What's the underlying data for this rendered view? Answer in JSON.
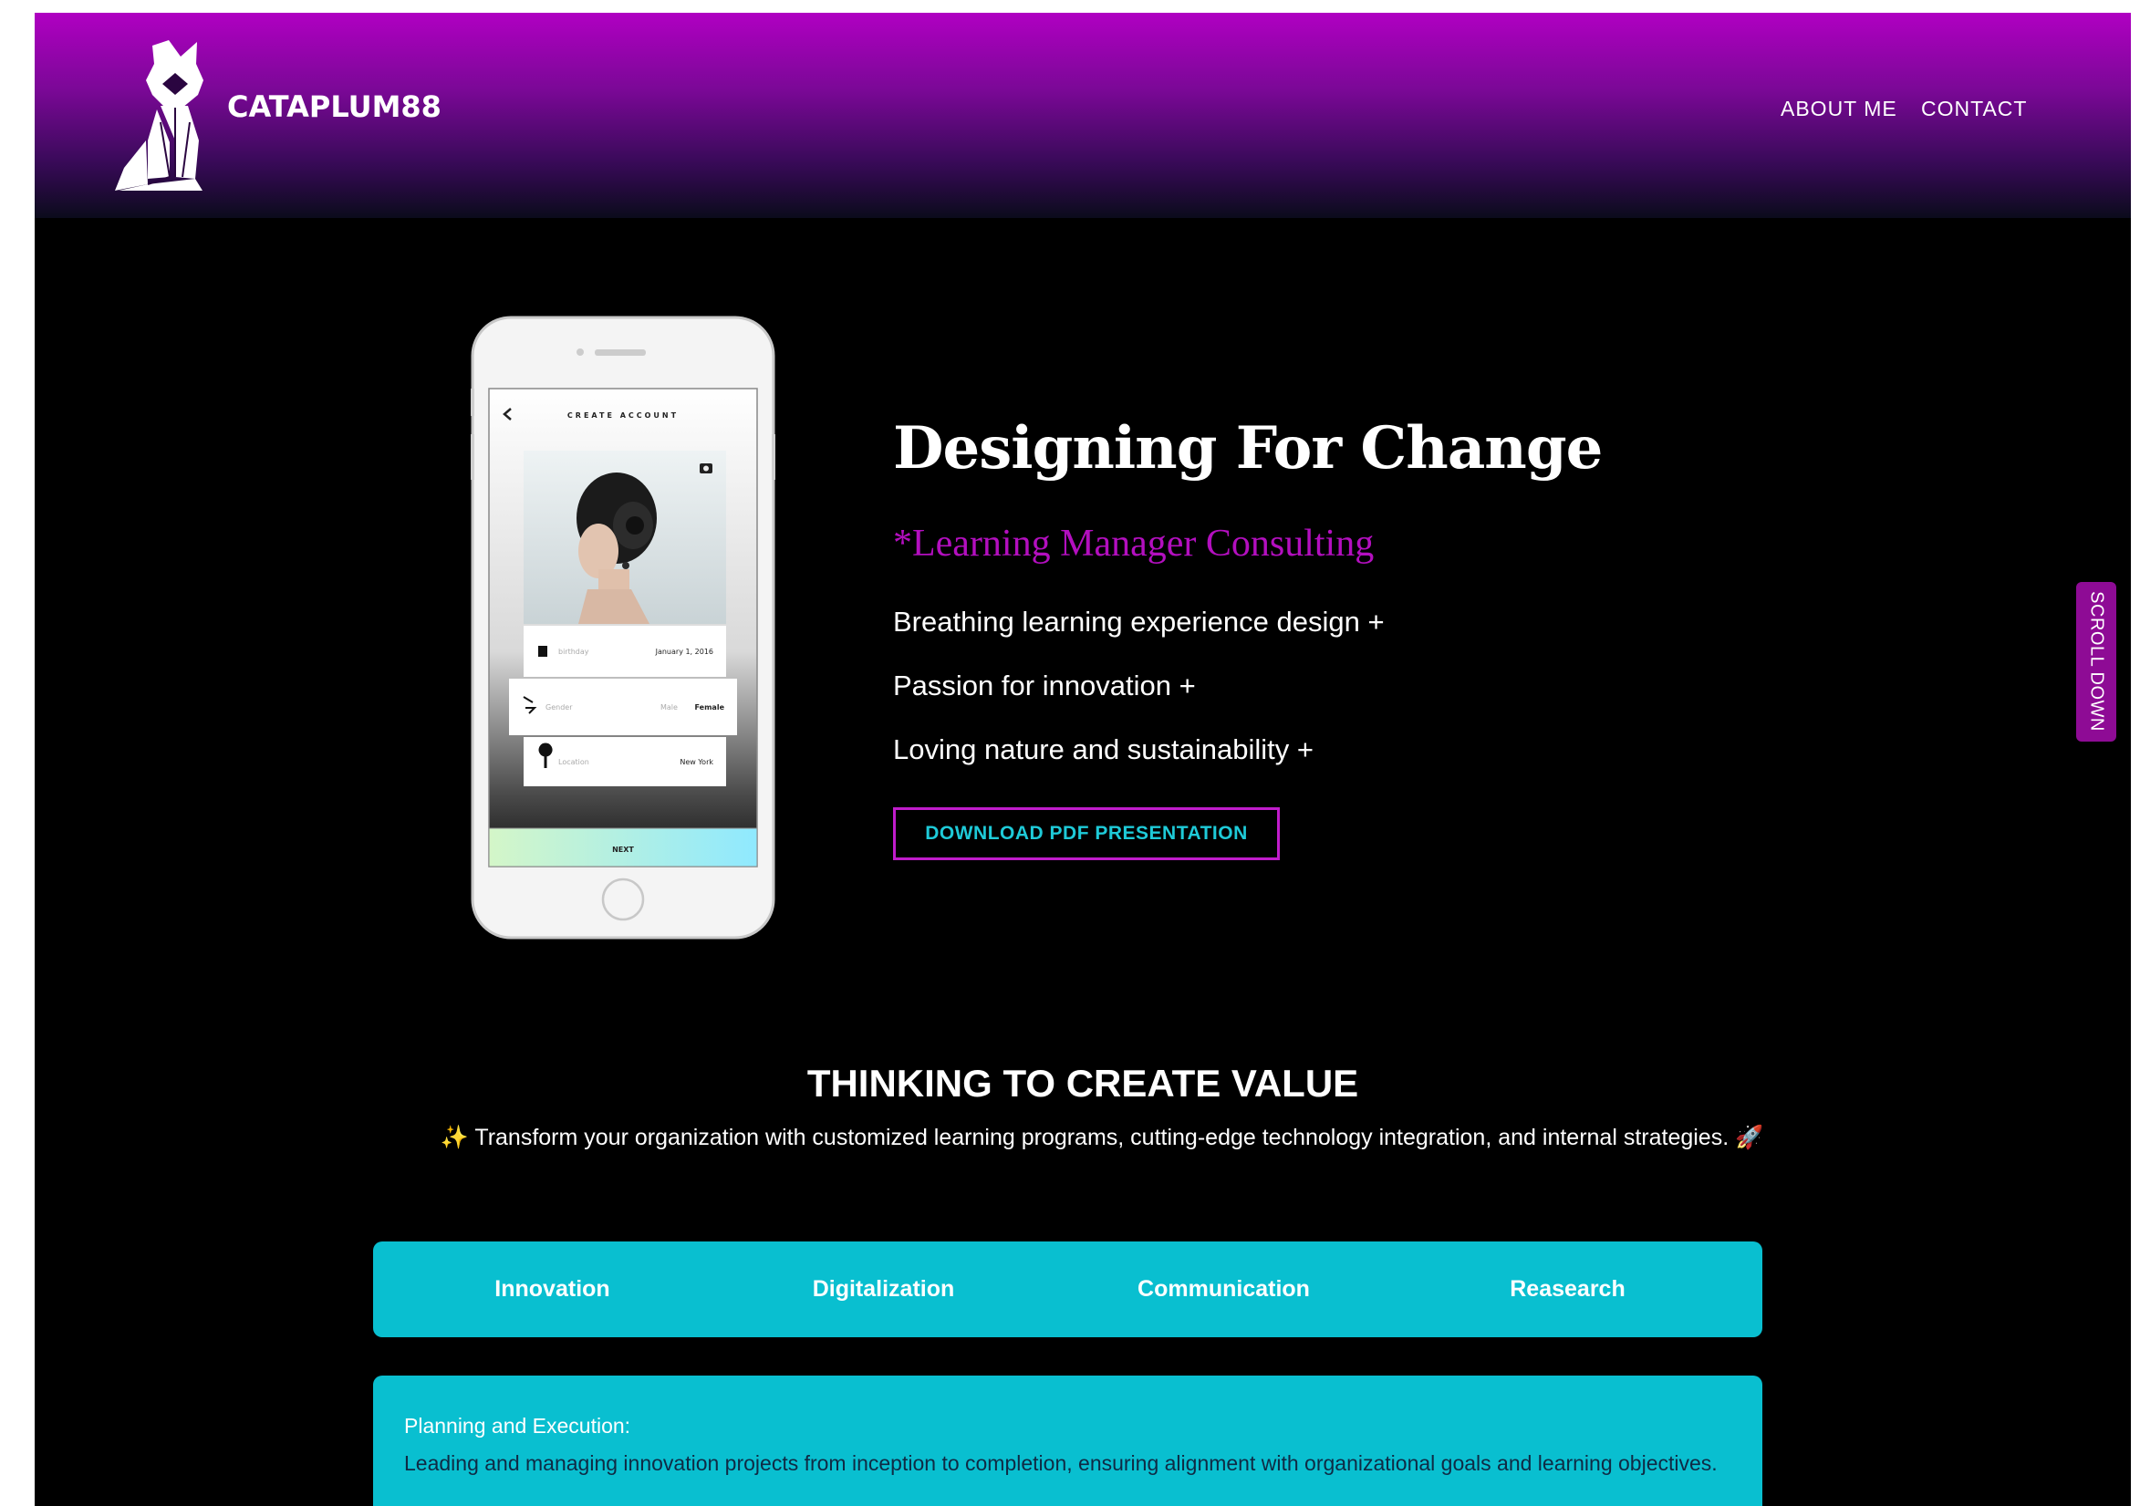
{
  "header": {
    "brand": "CATAPLUM88",
    "nav": [
      {
        "label": "ABOUT ME"
      },
      {
        "label": "CONTACT"
      }
    ]
  },
  "phone_mockup": {
    "screen_title": "CREATE ACCOUNT",
    "fields": [
      {
        "label": "birthday",
        "value": "January 1, 2016"
      },
      {
        "label": "Gender",
        "option_a": "Male",
        "option_b": "Female"
      },
      {
        "label": "Location",
        "value": "New York"
      }
    ],
    "next_label": "NEXT"
  },
  "hero": {
    "title": "Designing For Change",
    "subtitle": "*Learning Manager Consulting",
    "bullets": [
      "Breathing learning experience design +",
      "Passion for innovation +",
      "Loving nature and sustainability +"
    ],
    "cta": "DOWNLOAD PDF PRESENTATION"
  },
  "scroll_tab": "SCROLL DOWN",
  "section": {
    "title": "THINKING TO CREATE VALUE",
    "description": "✨ Transform your organization with customized learning programs, cutting-edge technology integration, and internal strategies. 🚀",
    "tabs": [
      "Innovation",
      "Digitalization",
      "Communication",
      "Reasearch"
    ],
    "card_heading": "Planning and Execution:",
    "card_text": "Leading and managing innovation projects from inception to completion, ensuring alignment with organizational goals and learning objectives."
  },
  "colors": {
    "header_top": "#b000c2",
    "accent_magenta": "#b30fbf",
    "accent_cyan": "#09bfd0",
    "page_bg": "#000000"
  }
}
